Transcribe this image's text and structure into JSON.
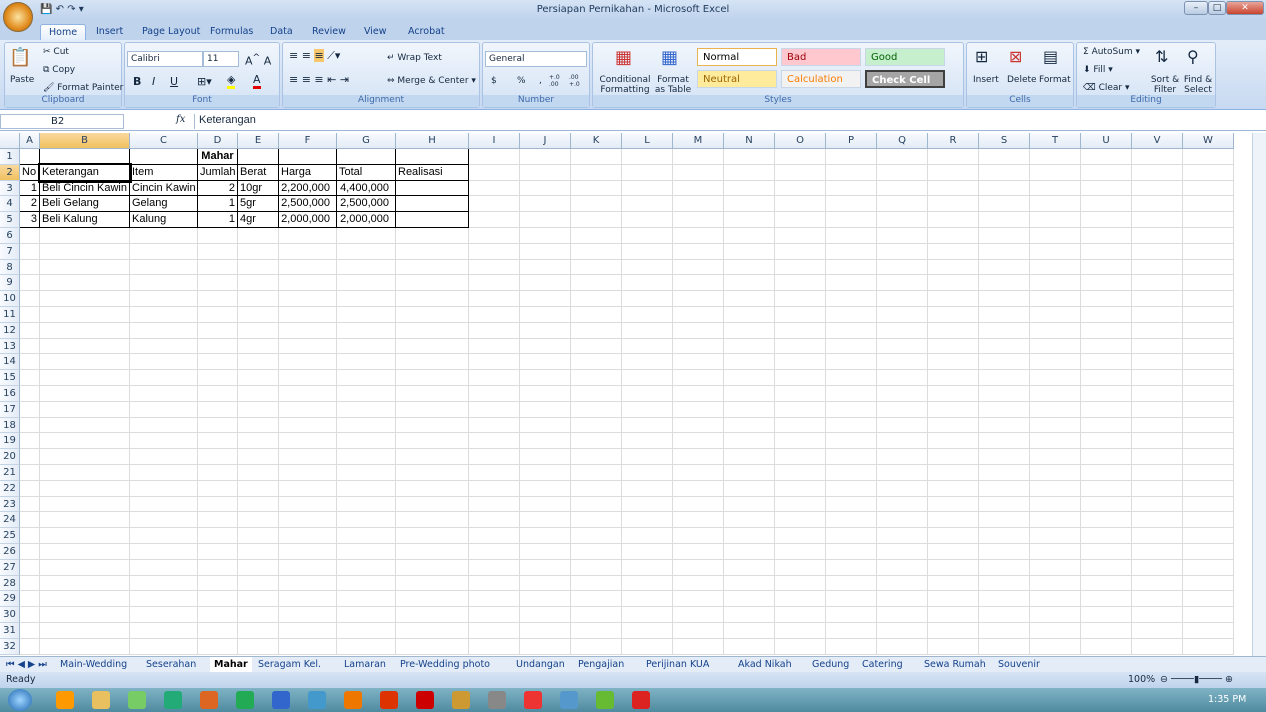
{
  "window": {
    "title": "Persiapan Pernikahan - Microsoft Excel"
  },
  "ribbon": {
    "tabs": [
      "Home",
      "Insert",
      "Page Layout",
      "Formulas",
      "Data",
      "Review",
      "View",
      "Acrobat"
    ],
    "active_tab": "Home",
    "clipboard": {
      "paste": "Paste",
      "cut": "Cut",
      "copy": "Copy",
      "format_painter": "Format Painter",
      "label": "Clipboard"
    },
    "font": {
      "name": "Calibri",
      "size": "11",
      "bold": "B",
      "italic": "I",
      "underline": "U",
      "label": "Font",
      "font_color": "#e00000",
      "fill_color": "#ffff00"
    },
    "alignment": {
      "wrap_text": "Wrap Text",
      "merge_center": "Merge & Center",
      "label": "Alignment"
    },
    "number": {
      "format": "General",
      "currency": "$",
      "percent": "%",
      "comma": ",",
      "inc_decimal": "+.0 .00",
      "dec_decimal": ".00 +.0",
      "label": "Number"
    },
    "styles": {
      "conditional": "Conditional Formatting",
      "format_table": "Format as Table",
      "label": "Styles",
      "cells": [
        {
          "name": "Normal",
          "bg": "#ffffff",
          "fg": "#000000"
        },
        {
          "name": "Bad",
          "bg": "#ffc7ce",
          "fg": "#9c0006"
        },
        {
          "name": "Good",
          "bg": "#c6efce",
          "fg": "#006100"
        },
        {
          "name": "Neutral",
          "bg": "#ffeb9c",
          "fg": "#9c6500"
        },
        {
          "name": "Calculation",
          "bg": "#f2f2f2",
          "fg": "#fa7d00"
        },
        {
          "name": "Check Cell",
          "bg": "#a5a5a5",
          "fg": "#ffffff"
        }
      ]
    },
    "cells": {
      "insert": "Insert",
      "delete": "Delete",
      "format": "Format",
      "label": "Cells"
    },
    "editing": {
      "autosum": "AutoSum",
      "fill": "Fill",
      "clear": "Clear",
      "sort_filter": "Sort & Filter",
      "find_select": "Find & Select",
      "label": "Editing"
    }
  },
  "formula_bar": {
    "name_box": "B2",
    "fx": "fx",
    "value": "Keterangan"
  },
  "sheet": {
    "columns": [
      "A",
      "B",
      "C",
      "D",
      "E",
      "F",
      "G",
      "H",
      "I",
      "J",
      "K",
      "L",
      "M",
      "N",
      "O",
      "P",
      "Q",
      "R",
      "S",
      "T",
      "U",
      "V",
      "W"
    ],
    "selected_column": "B",
    "selected_row": 2,
    "row_count": 32,
    "title": "Mahar",
    "headers": [
      "No",
      "Keterangan",
      "Item",
      "Jumlah",
      "Berat",
      "Harga",
      "Total",
      "Realisasi"
    ],
    "rows": [
      [
        "1",
        "Beli Cincin Kawin",
        "Cincin Kawin",
        "2",
        "10gr",
        "2,200,000",
        "4,400,000",
        ""
      ],
      [
        "2",
        "Beli Gelang",
        "Gelang",
        "1",
        "5gr",
        "2,500,000",
        "2,500,000",
        ""
      ],
      [
        "3",
        "Beli Kalung",
        "Kalung",
        "1",
        "4gr",
        "2,000,000",
        "2,000,000",
        ""
      ]
    ]
  },
  "sheet_tabs": [
    "Main-Wedding",
    "Seserahan",
    "Mahar",
    "Seragam Kel.",
    "Lamaran",
    "Pre-Wedding photo",
    "Undangan",
    "Pengajian",
    "Perijinan KUA",
    "Akad Nikah",
    "Gedung",
    "Catering",
    "Sewa Rumah",
    "Souvenir"
  ],
  "active_sheet": "Mahar",
  "status": {
    "text": "Ready",
    "zoom": "100%"
  },
  "taskbar": {
    "clock": "1:35 PM"
  }
}
